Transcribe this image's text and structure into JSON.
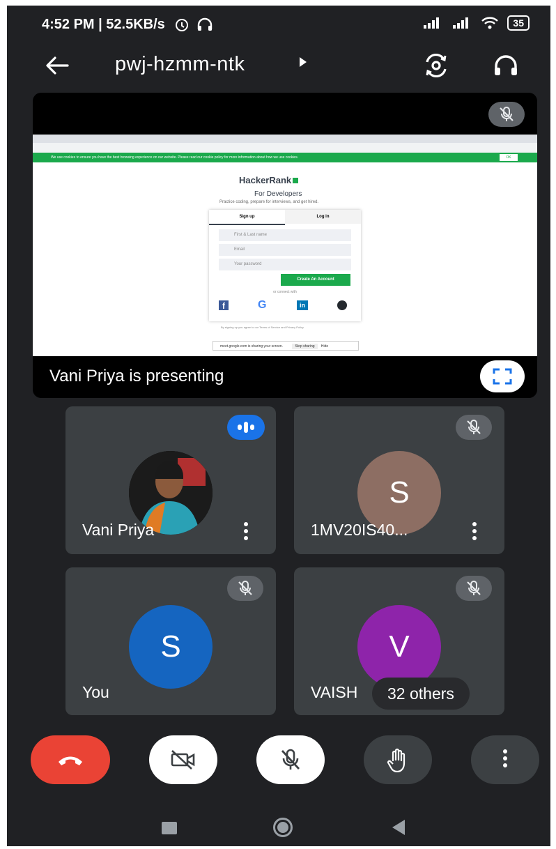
{
  "status_bar": {
    "time": "4:52 PM | 52.5KB/s",
    "battery": "35"
  },
  "top_bar": {
    "meeting_code": "pwj-hzmm-ntk"
  },
  "presentation": {
    "label": "Vani Priya is presenting",
    "shared_screen": {
      "cookie_text": "We use cookies to ensure you have the best browsing experience on our website. Please read our cookie policy for more information about how we use cookies.",
      "cookie_ok": "OK",
      "logo": "HackerRank",
      "heading": "For Developers",
      "subheading": "Practice coding, prepare for interviews, and get hired.",
      "tab_signup": "Sign up",
      "tab_login": "Log in",
      "field_name": "First & Last name",
      "field_email": "Email",
      "field_password": "Your password",
      "create_button": "Create An Account",
      "or_connect": "or connect with",
      "terms": "By signing up you agree to our Terms of Service and Privacy Policy",
      "share_bar_text": "meet.google.com is sharing your screen.",
      "share_stop": "Stop sharing",
      "share_hide": "Hide"
    }
  },
  "participants": [
    {
      "name": "Vani Priya",
      "initial": "",
      "avatar_color": "#000000",
      "status": "speaking"
    },
    {
      "name": "1MV20IS40...",
      "initial": "S",
      "avatar_color": "#8d6e63",
      "status": "muted"
    },
    {
      "name": "You",
      "initial": "S",
      "avatar_color": "#1565c0",
      "status": "muted"
    },
    {
      "name": "VAISH",
      "initial": "V",
      "avatar_color": "#8e24aa",
      "status": "muted"
    }
  ],
  "others_badge": "32 others",
  "colors": {
    "background": "#202124",
    "tile": "#3c4043",
    "end_call": "#ea4335",
    "speaking": "#1a73e8"
  }
}
